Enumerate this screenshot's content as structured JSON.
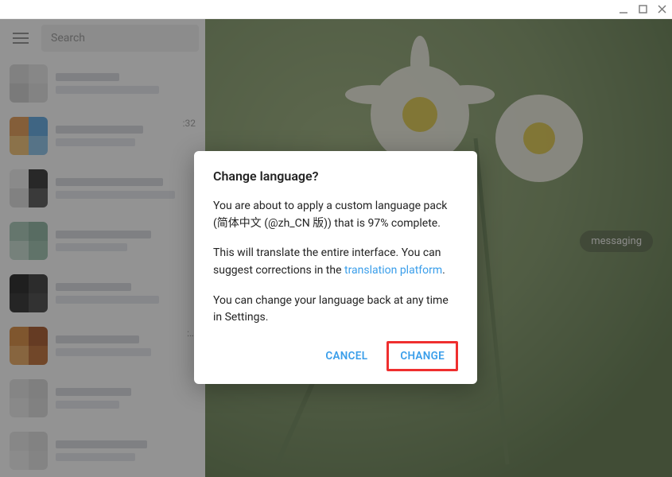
{
  "window_controls": {
    "minimize": "–",
    "maximize": "□",
    "close": "×"
  },
  "sidebar": {
    "search_placeholder": "Search",
    "chats": [
      {
        "time": ""
      },
      {
        "time": ":32"
      },
      {
        "time": ""
      },
      {
        "time": ""
      },
      {
        "time": ""
      },
      {
        "time": ":…"
      },
      {
        "time": ""
      },
      {
        "time": ""
      },
      {
        "time": ""
      }
    ]
  },
  "main": {
    "pill_text": "messaging"
  },
  "modal": {
    "title": "Change language?",
    "para1": "You are about to apply a custom language pack (简体中文 (@zh_CN 版)) that is 97% complete.",
    "para2_before": "This will translate the entire interface. You can suggest corrections in the ",
    "para2_link": "translation platform",
    "para2_after": ".",
    "para3": "You can change your language back at any time in Settings.",
    "cancel_label": "CANCEL",
    "change_label": "CHANGE"
  }
}
